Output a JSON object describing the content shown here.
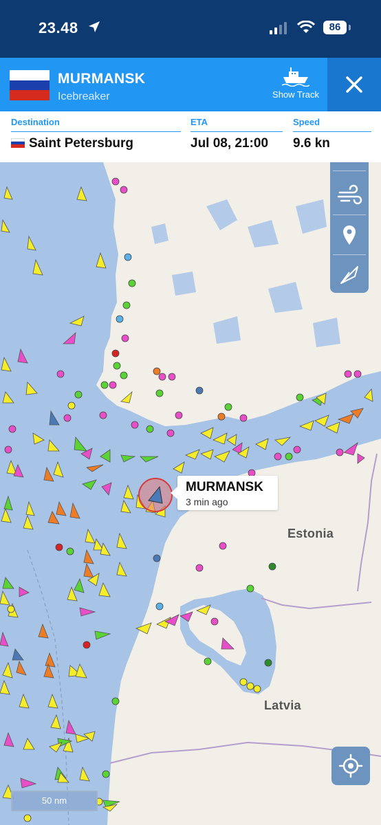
{
  "status_bar": {
    "time": "23.48",
    "battery": "86"
  },
  "vessel": {
    "name": "MURMANSK",
    "type": "Icebreaker",
    "flag_colors": [
      "#ffffff",
      "#1c3fae",
      "#d52b1e"
    ]
  },
  "header": {
    "show_track_label": "Show Track"
  },
  "info": {
    "destination_label": "Destination",
    "destination_value": "Saint Petersburg",
    "eta_label": "ETA",
    "eta_value": "Jul 08, 21:00",
    "speed_label": "Speed",
    "speed_value": "9.6 kn"
  },
  "map": {
    "label_name": "MURMANSK",
    "label_time": "3 min ago",
    "countries": [
      "Estonia",
      "Latvia"
    ],
    "scale": "50 nm",
    "colors": {
      "sea": "#a7c3e6",
      "land": "#f2efe9",
      "lake": "#b3cbe8"
    }
  }
}
